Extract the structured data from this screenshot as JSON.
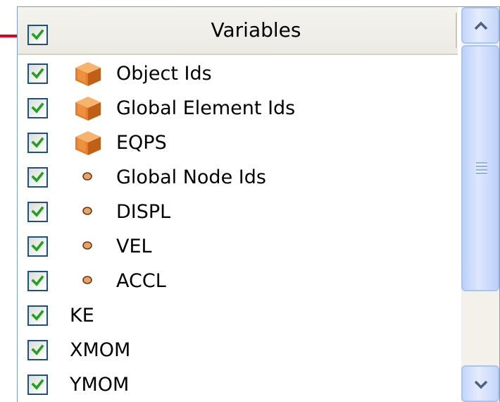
{
  "header": {
    "title": "Variables",
    "checked": true
  },
  "items": [
    {
      "label": "Object Ids",
      "icon": "cube-icon",
      "checked": true
    },
    {
      "label": "Global Element Ids",
      "icon": "cube-icon",
      "checked": true
    },
    {
      "label": "EQPS",
      "icon": "cube-icon",
      "checked": true
    },
    {
      "label": "Global Node Ids",
      "icon": "node-dot-icon",
      "checked": true
    },
    {
      "label": "DISPL",
      "icon": "node-dot-icon",
      "checked": true
    },
    {
      "label": "VEL",
      "icon": "node-dot-icon",
      "checked": true
    },
    {
      "label": "ACCL",
      "icon": "node-dot-icon",
      "checked": true
    },
    {
      "label": "KE",
      "icon": "",
      "checked": true
    },
    {
      "label": "XMOM",
      "icon": "",
      "checked": true
    },
    {
      "label": "YMOM",
      "icon": "",
      "checked": true
    }
  ],
  "colors": {
    "arrow": "#e0001b",
    "checkmark": "#21a121",
    "checkbox_border": "#1c5180",
    "cube": "#e57e2c",
    "scrollbar": "#c5d6fb"
  }
}
